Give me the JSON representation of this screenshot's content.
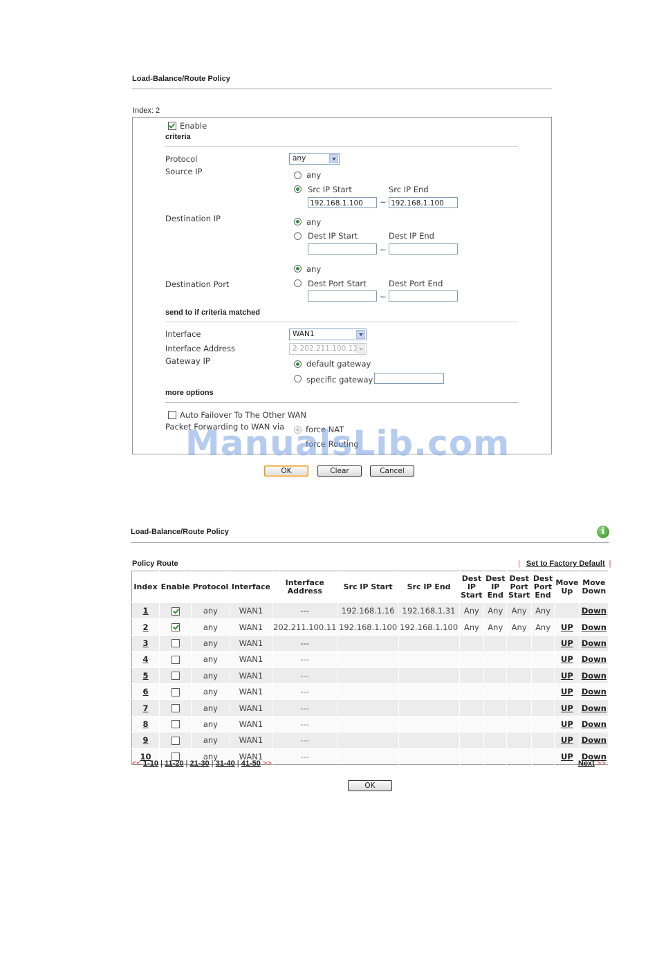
{
  "form": {
    "title": "Load-Balance/Route Policy",
    "index_label": "Index: 2",
    "enable_label": "Enable",
    "enable_checked": true,
    "criteria_header": "criteria",
    "protocol_label": "Protocol",
    "protocol_value": "any",
    "source_ip_label": "Source IP",
    "src_any": "any",
    "src_ip_start_label": "Src IP Start",
    "src_ip_end_label": "Src IP End",
    "src_ip_start_value": "192.168.1.100",
    "src_ip_end_value": "192.168.1.100",
    "dest_ip_label": "Destination IP",
    "dest_any": "any",
    "dest_ip_start_label": "Dest IP Start",
    "dest_ip_end_label": "Dest IP End",
    "dest_port_label": "Destination Port",
    "port_any": "any",
    "dest_port_start_label": "Dest Port Start",
    "dest_port_end_label": "Dest Port End",
    "tilde": "~",
    "send_header": "send to if criteria matched",
    "interface_label": "Interface",
    "interface_value": "WAN1",
    "interface_address_label": "Interface Address",
    "interface_address_value": "2-202.211.100.11",
    "gateway_ip_label": "Gateway IP",
    "default_gateway": "default gateway",
    "specific_gateway": "specific gateway",
    "more_header": "more options",
    "failover_label": "Auto Failover To The Other WAN",
    "packet_forwarding_label": "Packet Forwarding to WAN via",
    "force_nat": "force NAT",
    "force_routing": "force Routing",
    "ok": "OK",
    "clear": "Clear",
    "cancel": "Cancel"
  },
  "watermark": "ManualsLib.com",
  "list": {
    "title": "Load-Balance/Route Policy",
    "section": "Policy Route",
    "factory_default": "Set to Factory Default",
    "separator": "|",
    "headers": {
      "index": "Index",
      "enable": "Enable",
      "protocol": "Protocol",
      "interface": "Interface",
      "interface_address_1": "Interface",
      "interface_address_2": "Address",
      "src_ip_start": "Src IP Start",
      "src_ip_end": "Src IP End",
      "dest_ip_start": [
        "Dest",
        "IP",
        "Start"
      ],
      "dest_ip_end": [
        "Dest",
        "IP",
        "End"
      ],
      "dest_port_start": [
        "Dest",
        "Port",
        "Start"
      ],
      "dest_port_end": [
        "Dest",
        "Port",
        "End"
      ],
      "move_up": [
        "Move",
        "Up"
      ],
      "move_down": [
        "Move",
        "Down"
      ]
    },
    "rows": [
      {
        "index": "1",
        "enabled": true,
        "protocol": "any",
        "interface": "WAN1",
        "address": "---",
        "src_start": "192.168.1.16",
        "src_end": "192.168.1.31",
        "dip_start": "Any",
        "dip_end": "Any",
        "dport_start": "Any",
        "dport_end": "Any",
        "up": "",
        "down": "Down"
      },
      {
        "index": "2",
        "enabled": true,
        "protocol": "any",
        "interface": "WAN1",
        "address": "202.211.100.11",
        "src_start": "192.168.1.100",
        "src_end": "192.168.1.100",
        "dip_start": "Any",
        "dip_end": "Any",
        "dport_start": "Any",
        "dport_end": "Any",
        "up": "UP",
        "down": "Down"
      },
      {
        "index": "3",
        "enabled": false,
        "protocol": "any",
        "interface": "WAN1",
        "address": "---",
        "src_start": "",
        "src_end": "",
        "dip_start": "",
        "dip_end": "",
        "dport_start": "",
        "dport_end": "",
        "up": "UP",
        "down": "Down"
      },
      {
        "index": "4",
        "enabled": false,
        "protocol": "any",
        "interface": "WAN1",
        "address": "---",
        "src_start": "",
        "src_end": "",
        "dip_start": "",
        "dip_end": "",
        "dport_start": "",
        "dport_end": "",
        "up": "UP",
        "down": "Down"
      },
      {
        "index": "5",
        "enabled": false,
        "protocol": "any",
        "interface": "WAN1",
        "address": "---",
        "src_start": "",
        "src_end": "",
        "dip_start": "",
        "dip_end": "",
        "dport_start": "",
        "dport_end": "",
        "up": "UP",
        "down": "Down"
      },
      {
        "index": "6",
        "enabled": false,
        "protocol": "any",
        "interface": "WAN1",
        "address": "---",
        "src_start": "",
        "src_end": "",
        "dip_start": "",
        "dip_end": "",
        "dport_start": "",
        "dport_end": "",
        "up": "UP",
        "down": "Down"
      },
      {
        "index": "7",
        "enabled": false,
        "protocol": "any",
        "interface": "WAN1",
        "address": "---",
        "src_start": "",
        "src_end": "",
        "dip_start": "",
        "dip_end": "",
        "dport_start": "",
        "dport_end": "",
        "up": "UP",
        "down": "Down"
      },
      {
        "index": "8",
        "enabled": false,
        "protocol": "any",
        "interface": "WAN1",
        "address": "---",
        "src_start": "",
        "src_end": "",
        "dip_start": "",
        "dip_end": "",
        "dport_start": "",
        "dport_end": "",
        "up": "UP",
        "down": "Down"
      },
      {
        "index": "9",
        "enabled": false,
        "protocol": "any",
        "interface": "WAN1",
        "address": "---",
        "src_start": "",
        "src_end": "",
        "dip_start": "",
        "dip_end": "",
        "dport_start": "",
        "dport_end": "",
        "up": "UP",
        "down": "Down"
      },
      {
        "index": "10",
        "enabled": false,
        "protocol": "any",
        "interface": "WAN1",
        "address": "---",
        "src_start": "",
        "src_end": "",
        "dip_start": "",
        "dip_end": "",
        "dport_start": "",
        "dport_end": "",
        "up": "UP",
        "down": "Down"
      }
    ],
    "pages": [
      "1-10",
      "11-20",
      "21-30",
      "31-40",
      "41-50"
    ],
    "prev_arrows": "<<",
    "next_arrows": ">>",
    "next": "Next",
    "ok": "OK"
  }
}
